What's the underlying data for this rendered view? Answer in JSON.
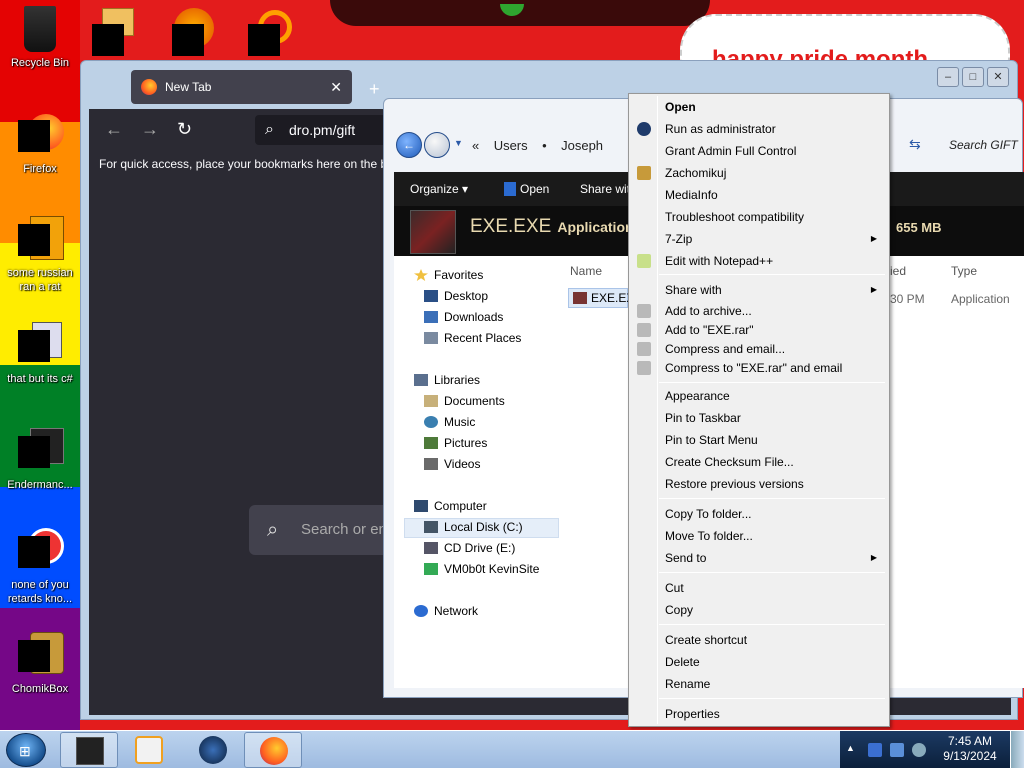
{
  "desktop": {
    "flag_colors": [
      "#e40303",
      "#ff8c00",
      "#ffed00",
      "#008026",
      "#004dff",
      "#750787"
    ],
    "banner": "happy pride month",
    "icons": [
      {
        "label": "Recycle Bin",
        "icon": "recycle-bin-icon"
      },
      {
        "label": "Firefox",
        "icon": "firefox-icon"
      },
      {
        "label": "some russian ran a rat",
        "icon": "file-icon"
      },
      {
        "label": "that but its c#",
        "icon": "file-icon"
      },
      {
        "label": "Endermanc...",
        "icon": "app-icon"
      },
      {
        "label": "none of you retards kno...",
        "icon": "app-icon"
      },
      {
        "label": "ChomikBox",
        "icon": "chomikbox-icon"
      }
    ]
  },
  "firefox": {
    "tab_title": "New Tab",
    "url": "dro.pm/gift",
    "bookmarks_hint": "For quick access, place your bookmarks here on the bo",
    "search_placeholder": "Search or en"
  },
  "explorer": {
    "breadcrumb": [
      "«",
      "Users",
      "•",
      "Joseph"
    ],
    "search_placeholder": "Search GIFT",
    "toolbar": {
      "organize": "Organize ▾",
      "open": "Open",
      "share": "Share wit"
    },
    "details": {
      "name": "EXE.EXE",
      "type": "Application",
      "size": "655 MB"
    },
    "nav": {
      "favorites": "Favorites",
      "desktop": "Desktop",
      "downloads": "Downloads",
      "recent": "Recent Places",
      "libraries": "Libraries",
      "documents": "Documents",
      "music": "Music",
      "pictures": "Pictures",
      "videos": "Videos",
      "computer": "Computer",
      "local_disk": "Local Disk (C:)",
      "cd_drive": "CD Drive (E:)",
      "vm": "VM0b0t KevinSite",
      "network": "Network"
    },
    "columns": {
      "name": "Name",
      "modified": "ied",
      "type": "Type"
    },
    "file": {
      "name": "EXE.EXE",
      "time": "30 PM",
      "type": "Application"
    }
  },
  "context_menu": {
    "items": [
      {
        "label": "Open",
        "bold": true
      },
      {
        "label": "Run as administrator",
        "icon": "shield-icon"
      },
      {
        "label": "Grant Admin Full Control"
      },
      {
        "label": "Zachomikuj",
        "icon": "chomikbox-icon"
      },
      {
        "label": "MediaInfo"
      },
      {
        "label": "Troubleshoot compatibility"
      },
      {
        "label": "7-Zip",
        "submenu": true
      },
      {
        "label": "Edit with Notepad++",
        "icon": "notepadpp-icon"
      },
      {
        "label": "Share with",
        "submenu": true
      },
      {
        "label": "Add to archive...",
        "icon": "rar-icon"
      },
      {
        "label": "Add to \"EXE.rar\"",
        "icon": "rar-icon"
      },
      {
        "label": "Compress and email...",
        "icon": "rar-icon"
      },
      {
        "label": "Compress to \"EXE.rar\" and email",
        "icon": "rar-icon"
      },
      {
        "label": "Appearance"
      },
      {
        "label": "Pin to Taskbar"
      },
      {
        "label": "Pin to Start Menu"
      },
      {
        "label": "Create Checksum File..."
      },
      {
        "label": "Restore previous versions"
      },
      {
        "label": "Copy To folder..."
      },
      {
        "label": "Move To folder..."
      },
      {
        "label": "Send to",
        "submenu": true
      },
      {
        "label": "Cut"
      },
      {
        "label": "Copy"
      },
      {
        "label": "Create shortcut"
      },
      {
        "label": "Delete"
      },
      {
        "label": "Rename"
      },
      {
        "label": "Properties"
      }
    ]
  },
  "taskbar": {
    "time": "7:45 AM",
    "date": "9/13/2024",
    "apps": [
      "terminal-icon",
      "media-player-icon",
      "globe-icon",
      "firefox-icon"
    ]
  }
}
